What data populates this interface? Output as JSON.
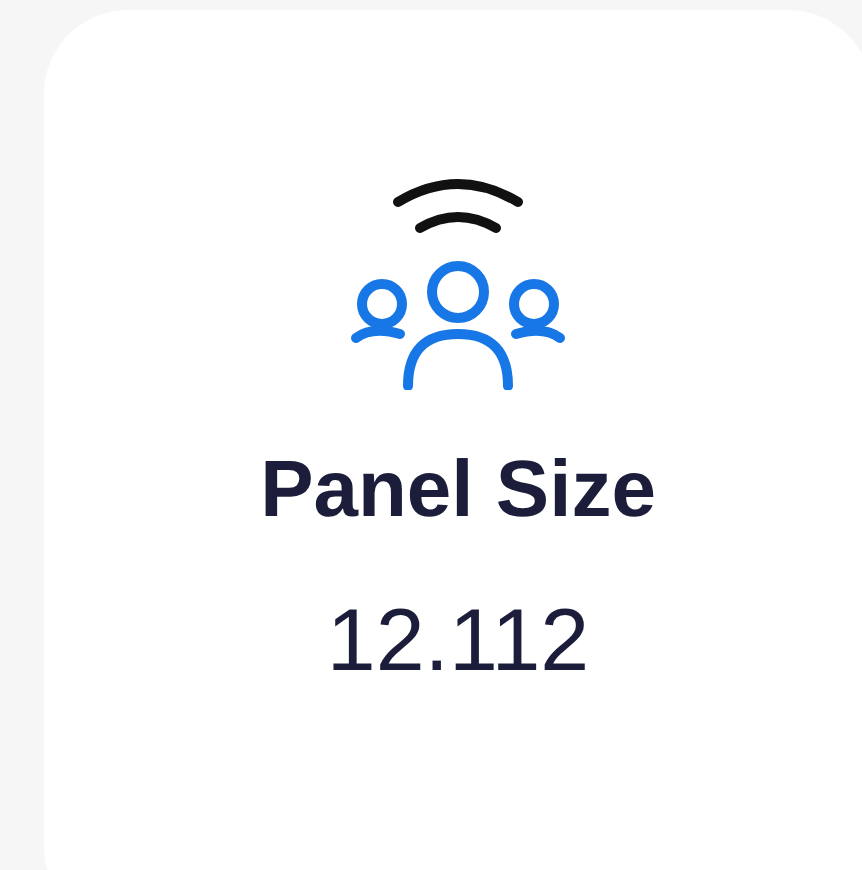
{
  "card": {
    "title": "Panel Size",
    "value": "12.112"
  }
}
